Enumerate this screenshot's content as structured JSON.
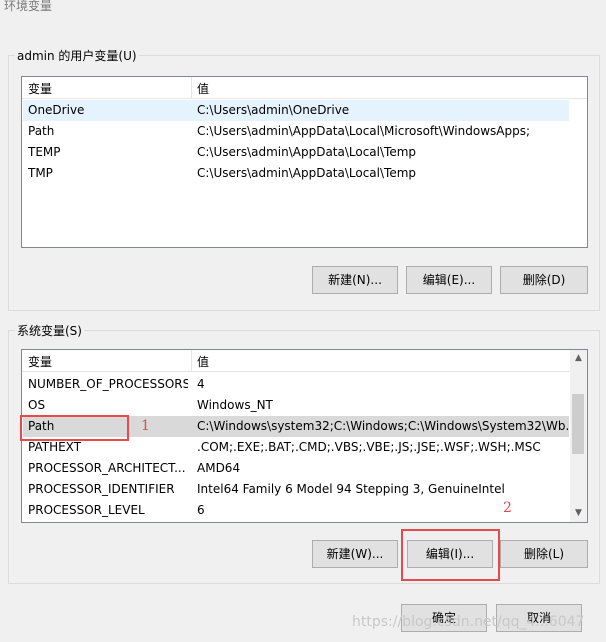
{
  "window": {
    "title": "环境变量"
  },
  "user_vars": {
    "legend": "admin 的用户变量(U)",
    "columns": [
      "变量",
      "值"
    ],
    "rows": [
      {
        "name": "OneDrive",
        "value": "C:\\Users\\admin\\OneDrive"
      },
      {
        "name": "Path",
        "value": "C:\\Users\\admin\\AppData\\Local\\Microsoft\\WindowsApps;"
      },
      {
        "name": "TEMP",
        "value": "C:\\Users\\admin\\AppData\\Local\\Temp"
      },
      {
        "name": "TMP",
        "value": "C:\\Users\\admin\\AppData\\Local\\Temp"
      }
    ],
    "buttons": {
      "new": "新建(N)...",
      "edit": "编辑(E)...",
      "delete": "删除(D)"
    }
  },
  "system_vars": {
    "legend": "系统变量(S)",
    "columns": [
      "变量",
      "值"
    ],
    "rows": [
      {
        "name": "NUMBER_OF_PROCESSORS",
        "value": "4"
      },
      {
        "name": "OS",
        "value": "Windows_NT"
      },
      {
        "name": "Path",
        "value": "C:\\Windows\\system32;C:\\Windows;C:\\Windows\\System32\\Wb..."
      },
      {
        "name": "PATHEXT",
        "value": ".COM;.EXE;.BAT;.CMD;.VBS;.VBE;.JS;.JSE;.WSF;.WSH;.MSC"
      },
      {
        "name": "PROCESSOR_ARCHITECT...",
        "value": "AMD64"
      },
      {
        "name": "PROCESSOR_IDENTIFIER",
        "value": "Intel64 Family 6 Model 94 Stepping 3, GenuineIntel"
      },
      {
        "name": "PROCESSOR_LEVEL",
        "value": "6"
      }
    ],
    "buttons": {
      "new": "新建(W)...",
      "edit": "编辑(I)...",
      "delete": "删除(L)"
    }
  },
  "dialog_buttons": {
    "ok": "确定",
    "cancel": "取消"
  },
  "annotations": {
    "one": "1",
    "two": "2"
  },
  "watermark": "https://blog.csdn.net/qq_4...6047",
  "colors": {
    "annotation_red": "#e64a4a",
    "selected_row": "#e5f3ff"
  },
  "icons": {
    "scroll_up": "chevron-up-icon",
    "scroll_down": "chevron-down-icon"
  }
}
